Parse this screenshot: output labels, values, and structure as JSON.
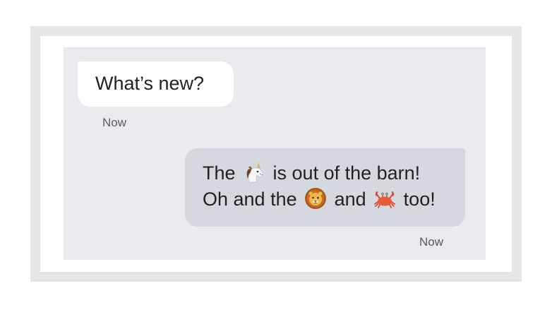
{
  "conversation": {
    "incoming": {
      "text": "What’s new?",
      "timestamp": "Now"
    },
    "outgoing": {
      "line1_part1": "The",
      "line1_emoji": "unicorn-emoji",
      "line1_part2": "is out of the barn!",
      "line2_part1": "Oh and the",
      "line2_emoji1": "lion-emoji",
      "line2_part2": "and",
      "line2_emoji2": "crab-emoji",
      "line2_part3": "too!",
      "timestamp": "Now"
    }
  },
  "colors": {
    "frame": "#e6e6e6",
    "chat_background": "#e9ecef",
    "incoming_bubble": "#ffffff",
    "outgoing_bubble": "#d3d9de",
    "text": "#222222",
    "timestamp": "#5a5a5a"
  }
}
